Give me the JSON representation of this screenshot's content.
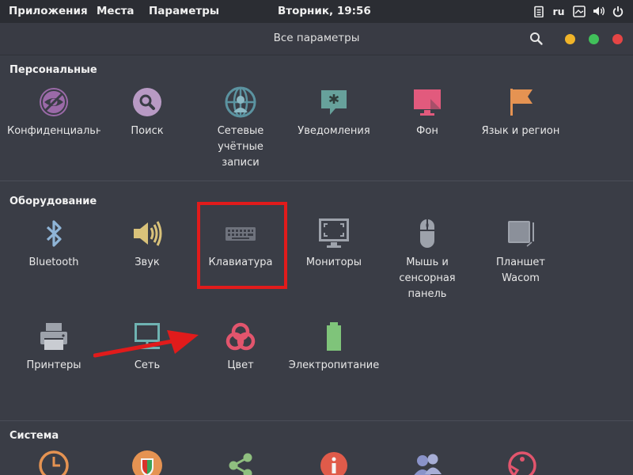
{
  "topbar": {
    "applications": "Приложения",
    "places": "Места",
    "settings": "Параметры",
    "clock": "Вторник, 19:56",
    "language": "ru"
  },
  "header": {
    "title": "Все параметры",
    "close_color": "#e54545",
    "maximize_color": "#41c05a",
    "minimize_color": "#f0b429"
  },
  "sections": {
    "personal": {
      "title": "Персональные",
      "items": [
        {
          "label": "Конфиденциальность",
          "icon": "privacy-icon"
        },
        {
          "label": "Поиск",
          "icon": "search-icon"
        },
        {
          "label": "Сетевые\nучётные\nзаписи",
          "icon": "online-accounts-icon"
        },
        {
          "label": "Уведомления",
          "icon": "notifications-icon"
        },
        {
          "label": "Фон",
          "icon": "background-icon"
        },
        {
          "label": "Язык и регион",
          "icon": "region-flag-icon"
        }
      ]
    },
    "hardware": {
      "title": "Оборудование",
      "items": [
        {
          "label": "Bluetooth",
          "icon": "bluetooth-icon"
        },
        {
          "label": "Звук",
          "icon": "sound-icon"
        },
        {
          "label": "Клавиатура",
          "icon": "keyboard-icon"
        },
        {
          "label": "Мониторы",
          "icon": "display-icon"
        },
        {
          "label": "Мышь и\nсенсорная\nпанель",
          "icon": "mouse-icon"
        },
        {
          "label": "Планшет\nWacom",
          "icon": "wacom-tablet-icon"
        },
        {
          "label": "Принтеры",
          "icon": "printer-icon"
        },
        {
          "label": "Сеть",
          "icon": "network-icon"
        },
        {
          "label": "Цвет",
          "icon": "color-icon"
        },
        {
          "label": "Электропитание",
          "icon": "power-battery-icon"
        }
      ]
    },
    "system": {
      "title": "Система",
      "items": [
        {
          "label": "",
          "icon": "clock-icon"
        },
        {
          "label": "",
          "icon": "shield-icon"
        },
        {
          "label": "",
          "icon": "share-icon"
        },
        {
          "label": "",
          "icon": "info-icon"
        },
        {
          "label": "",
          "icon": "users-icon"
        },
        {
          "label": "",
          "icon": "universal-access-icon"
        }
      ]
    }
  },
  "colors": {
    "background": "#3a3d46",
    "topbar": "#2b2d33",
    "annotation_red": "#e11b1b"
  }
}
